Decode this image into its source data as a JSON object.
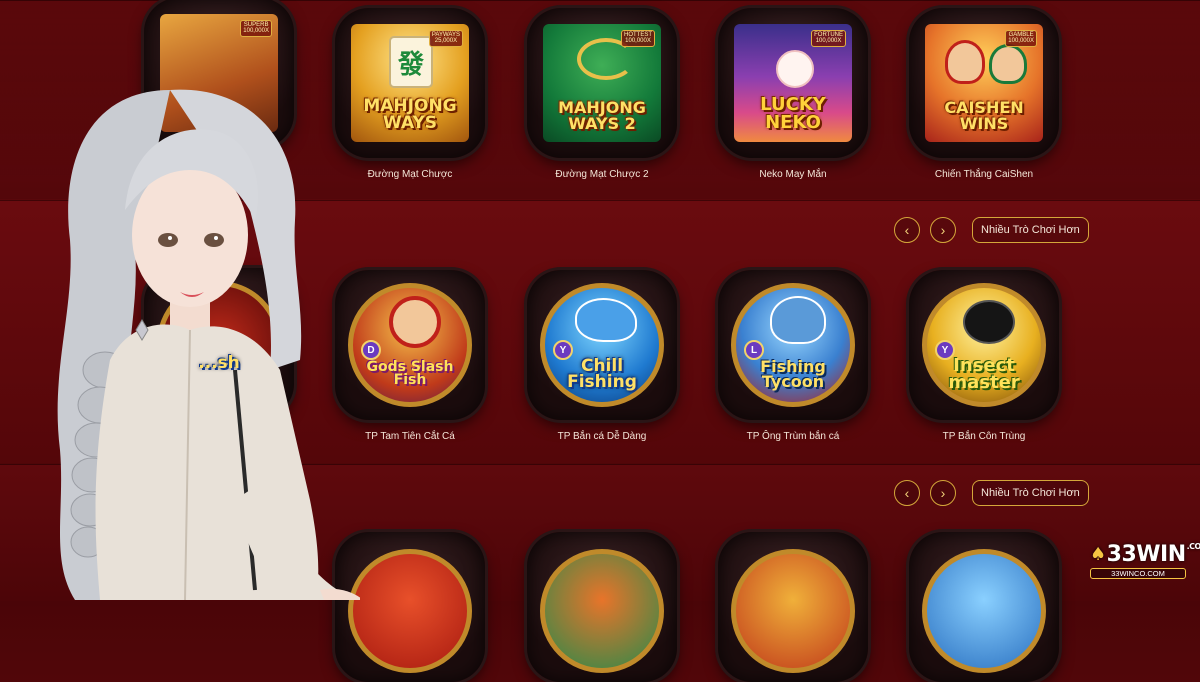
{
  "rows": [
    {
      "games": [
        {
          "label": "",
          "thumb_title": "",
          "badge": "SUPERB\n100,000X"
        },
        {
          "label": "Đường Mạt Chược",
          "thumb_title": "MAHJONG\nWAYS",
          "badge": "PAYWAYS\n25,000X"
        },
        {
          "label": "Đường Mạt Chược 2",
          "thumb_title": "MAHJONG\nWAYS 2",
          "badge": "HOTTEST\n100,000X"
        },
        {
          "label": "Neko May Mắn",
          "thumb_title": "LUCKY\nNEKO",
          "badge": "FORTUNE\n100,000X"
        },
        {
          "label": "Chiến Thắng CaiShen",
          "thumb_title": "CAISHEN\nWINS",
          "badge": "GAMBLE\n100,000X"
        }
      ]
    },
    {
      "controls": {
        "prev": "‹",
        "next": "›",
        "more": "Nhiều Trò Chơi Hơn"
      },
      "games": [
        {
          "label": "",
          "thumb_title": "...sh"
        },
        {
          "label": "TP Tam Tiên Cắt Cá",
          "thumb_title": "Gods Slash Fish",
          "letter": "D"
        },
        {
          "label": "TP Bắn cá Dễ Dàng",
          "thumb_title": "Chill\nFishing",
          "letter": "Y"
        },
        {
          "label": "TP Ông Trùm bắn cá",
          "thumb_title": "Fishing\nTycoon",
          "letter": "L"
        },
        {
          "label": "TP Bắn Côn Trùng",
          "thumb_title": "Insect\nmaster",
          "letter": "Y"
        }
      ]
    },
    {
      "controls": {
        "prev": "‹",
        "next": "›",
        "more": "Nhiều Trò Chơi Hơn"
      }
    }
  ],
  "logo": {
    "main": "33WIN",
    "co": ".CO",
    "url": "33WINCO.COM"
  },
  "colors": {
    "gold": "#d4a73a",
    "bg": "#5a080b"
  }
}
